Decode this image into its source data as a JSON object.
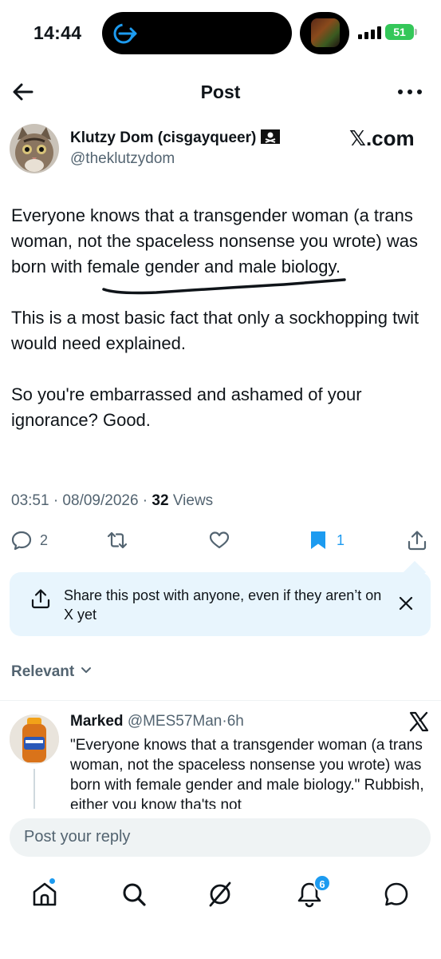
{
  "status_bar": {
    "time": "14:44",
    "battery": "51"
  },
  "nav": {
    "title": "Post"
  },
  "author": {
    "name": "Klutzy Dom (cisgayqueer)",
    "handle": "@theklutzydom",
    "source": "𝕏.com"
  },
  "post": {
    "paragraphs": [
      "Everyone knows that a transgender woman (a trans woman, not the spaceless nonsense you wrote) was born with female gender and male biology.",
      "This is a most basic fact that only a sockhopping twit would need explained.",
      "So you're embarrassed and ashamed of your ignorance? Good."
    ],
    "timestamp": "03:51 · 08/09/2026 · ",
    "views_count": "32",
    "views_label": " Views"
  },
  "actions": {
    "replies": "2",
    "bookmarks": "1"
  },
  "share_banner": {
    "text": "Share this post with anyone, even if they aren’t on X yet"
  },
  "sort": {
    "label": "Relevant"
  },
  "reply": {
    "name": "Marked",
    "handle": "@MES57Man",
    "age": "6h",
    "text": "\"Everyone knows that a transgender woman (a trans woman, not the spaceless nonsense you wrote) was born with female gender and male biology.\" Rubbish, either you know tha'ts not"
  },
  "composer": {
    "placeholder": "Post your reply"
  },
  "tabbar": {
    "notifications_badge": "6"
  },
  "colors": {
    "accent": "#1d9bf0",
    "text": "#0f1419",
    "muted": "#536471",
    "battery": "#34c759"
  },
  "icons": [
    "back-arrow-icon",
    "more-icon",
    "pirate-flag-icon",
    "x-logo-icon",
    "reply-icon",
    "repost-icon",
    "like-icon",
    "bookmark-icon",
    "share-icon",
    "close-icon",
    "chevron-down-icon",
    "home-icon",
    "search-icon",
    "grok-icon",
    "bell-icon",
    "chat-icon"
  ]
}
